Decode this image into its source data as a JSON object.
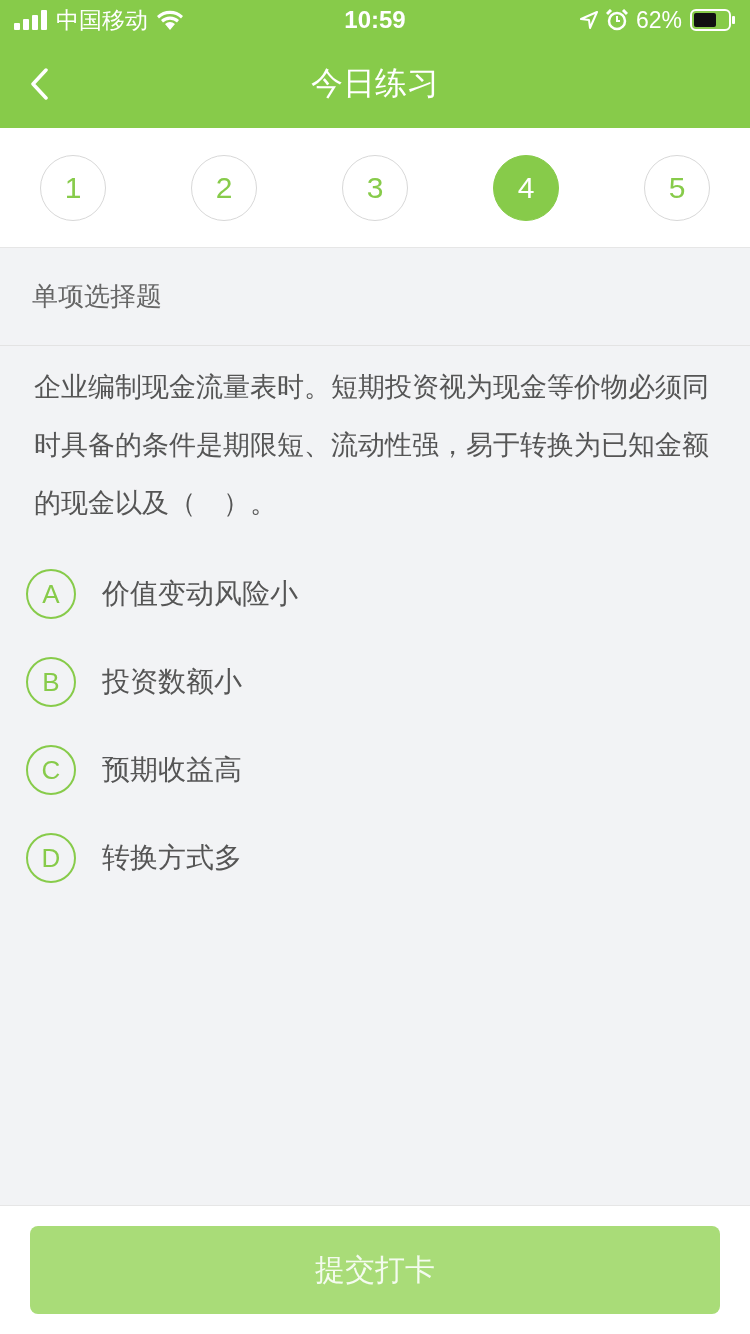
{
  "status_bar": {
    "carrier": "中国移动",
    "time": "10:59",
    "battery": "62%"
  },
  "nav": {
    "title": "今日练习"
  },
  "steps": [
    {
      "label": "1",
      "selected": false
    },
    {
      "label": "2",
      "selected": false
    },
    {
      "label": "3",
      "selected": false
    },
    {
      "label": "4",
      "selected": true
    },
    {
      "label": "5",
      "selected": false
    }
  ],
  "section": {
    "title": "单项选择题"
  },
  "question": {
    "text": "企业编制现金流量表时。短期投资视为现金等价物必须同时具备的条件是期限短、流动性强，易于转换为已知金额的现金以及（　）。"
  },
  "options": [
    {
      "letter": "A",
      "text": "价值变动风险小",
      "selected": false
    },
    {
      "letter": "B",
      "text": "投资数额小",
      "selected": false
    },
    {
      "letter": "C",
      "text": "预期收益高",
      "selected": false
    },
    {
      "letter": "D",
      "text": "转换方式多",
      "selected": false
    }
  ],
  "submit": {
    "label": "提交打卡",
    "disabled": true
  }
}
